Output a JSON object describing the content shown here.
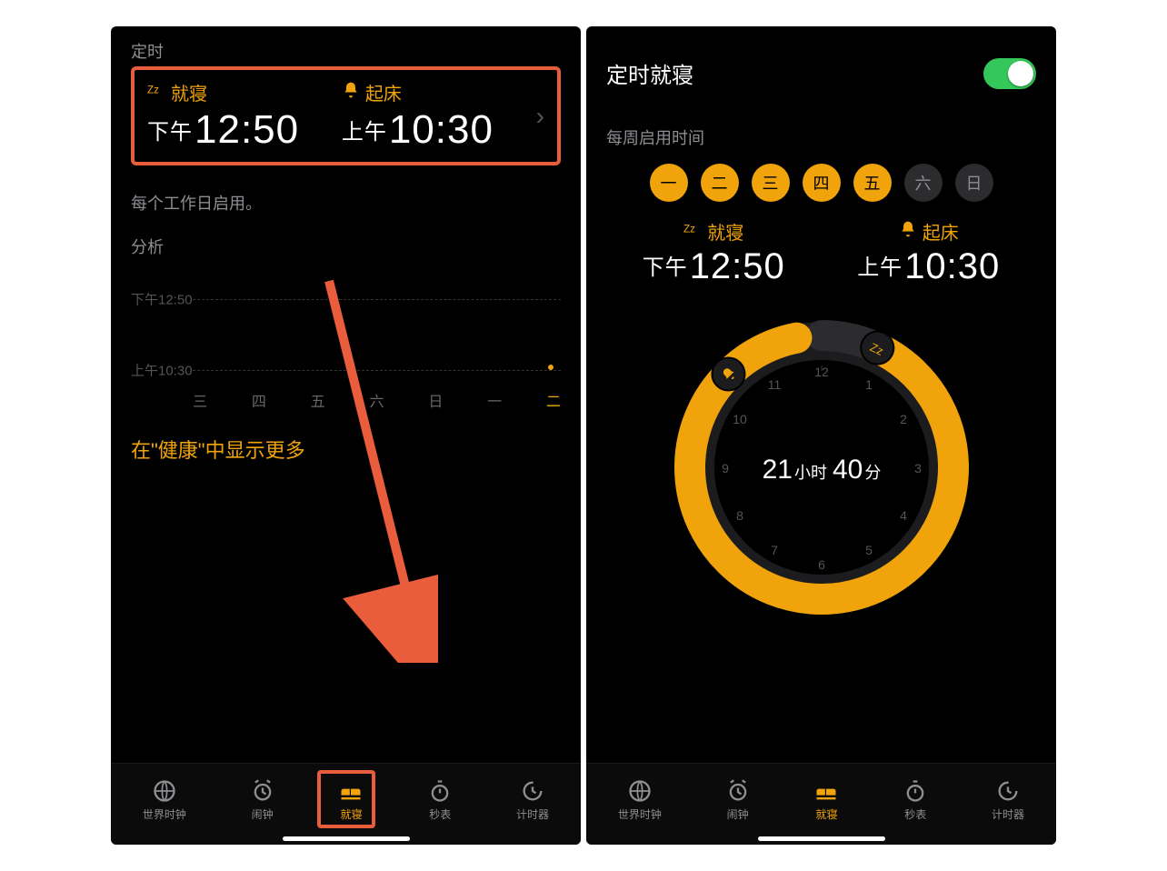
{
  "left": {
    "top_label": "定时",
    "bedtime_label": "就寝",
    "wake_label": "起床",
    "bedtime_ampm": "下午",
    "bedtime_time": "12:50",
    "wake_ampm": "上午",
    "wake_time": "10:30",
    "enable_text": "每个工作日启用。",
    "analysis_label": "分析",
    "ytick_top": "下午12:50",
    "ytick_bot": "上午10:30",
    "xdays": [
      "三",
      "四",
      "五",
      "六",
      "日",
      "一",
      "二"
    ],
    "show_more": "在\"健康\"中显示更多"
  },
  "right": {
    "title": "定时就寝",
    "toggle_on": true,
    "weekly_label": "每周启用时间",
    "days": [
      {
        "label": "一",
        "on": true
      },
      {
        "label": "二",
        "on": true
      },
      {
        "label": "三",
        "on": true
      },
      {
        "label": "四",
        "on": true
      },
      {
        "label": "五",
        "on": true
      },
      {
        "label": "六",
        "on": false
      },
      {
        "label": "日",
        "on": false
      }
    ],
    "bedtime_label": "就寝",
    "wake_label": "起床",
    "bedtime_ampm": "下午",
    "bedtime_time": "12:50",
    "wake_ampm": "上午",
    "wake_time": "10:30",
    "duration_hours": "21",
    "duration_hunit": "小时",
    "duration_mins": "40",
    "duration_munit": "分",
    "clock_numbers": [
      "12",
      "1",
      "2",
      "3",
      "4",
      "5",
      "6",
      "7",
      "8",
      "9",
      "10",
      "11"
    ]
  },
  "tabs": {
    "world": "世界时钟",
    "alarm": "闹钟",
    "bedtime": "就寝",
    "stopwatch": "秒表",
    "timer": "计时器"
  },
  "colors": {
    "accent": "#f0a30a",
    "highlight": "#e95c3c",
    "toggle": "#34c759"
  },
  "chart_data": {
    "type": "scatter",
    "title": "分析",
    "yticks": [
      "下午12:50",
      "上午10:30"
    ],
    "categories": [
      "三",
      "四",
      "五",
      "六",
      "日",
      "一",
      "二"
    ],
    "series": [
      {
        "name": "起床",
        "values": [
          null,
          null,
          null,
          null,
          null,
          null,
          "上午10:30"
        ]
      }
    ]
  }
}
